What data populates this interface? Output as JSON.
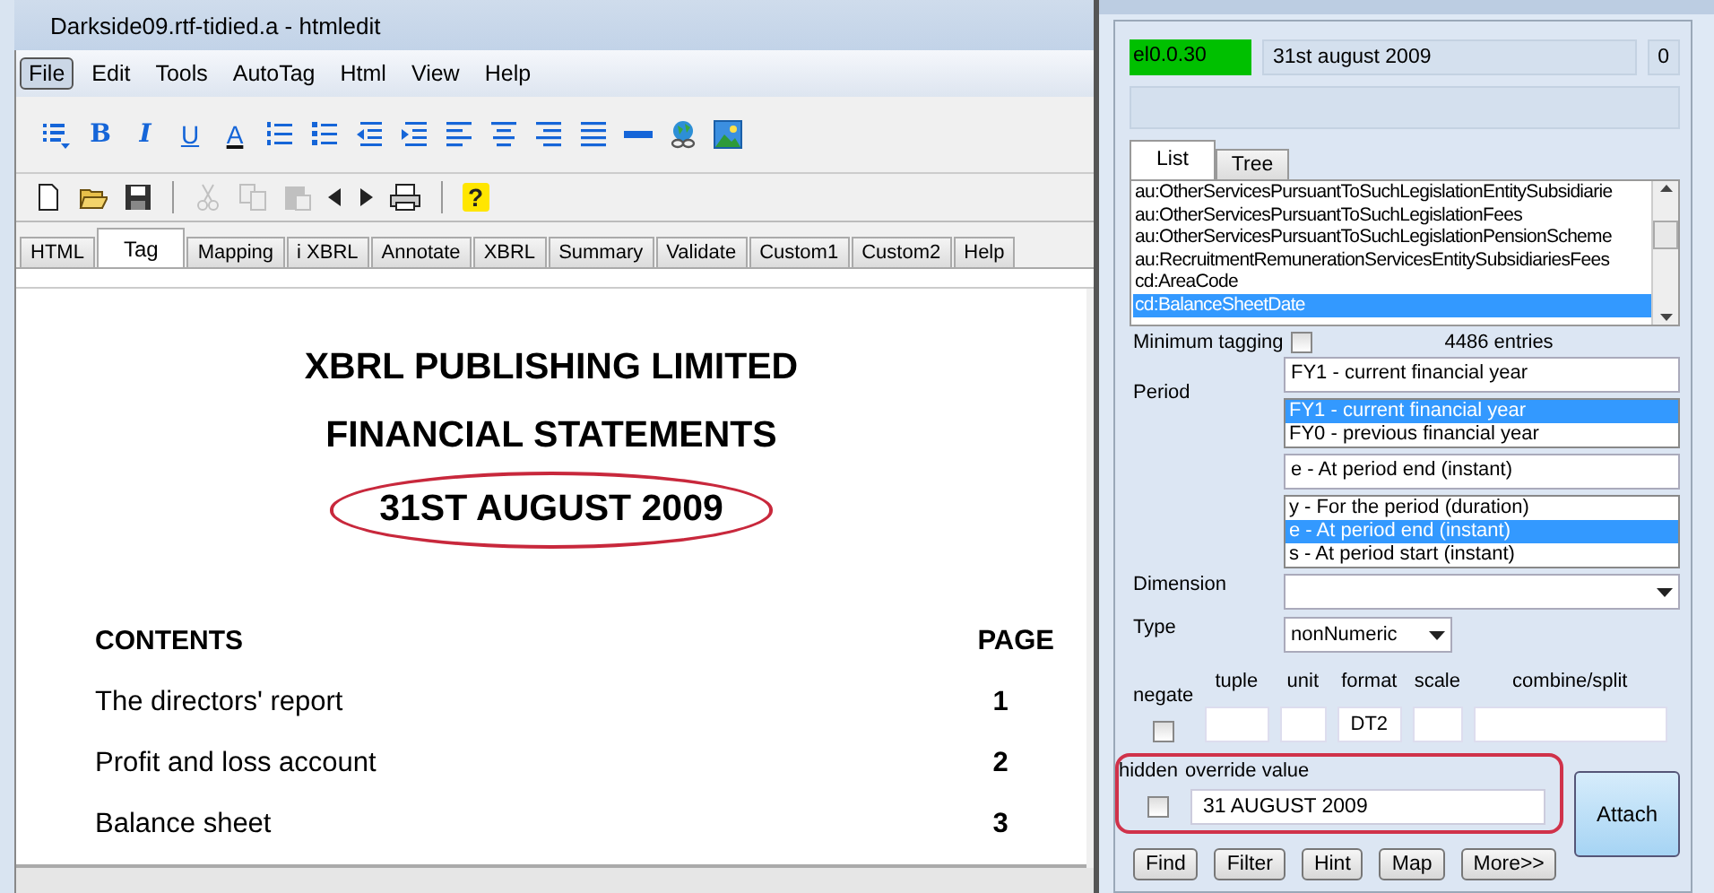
{
  "editor": {
    "title": "Darkside09.rtf-tidied.a - htmledit",
    "menu": [
      {
        "label": "File",
        "selected": true
      },
      {
        "label": "Edit",
        "selected": false
      },
      {
        "label": "Tools",
        "selected": false
      },
      {
        "label": "AutoTag",
        "selected": false
      },
      {
        "label": "Html",
        "selected": false
      },
      {
        "label": "View",
        "selected": false
      },
      {
        "label": "Help",
        "selected": false
      }
    ],
    "format_toolbar": [
      {
        "kind": "list-style"
      },
      {
        "kind": "bold",
        "label": "B"
      },
      {
        "kind": "italic",
        "label": "I"
      },
      {
        "kind": "underline",
        "label": "U"
      },
      {
        "kind": "font-color",
        "label": "A"
      },
      {
        "kind": "numbered-list"
      },
      {
        "kind": "bullet-list"
      },
      {
        "kind": "outdent"
      },
      {
        "kind": "indent"
      },
      {
        "kind": "align-left"
      },
      {
        "kind": "align-center"
      },
      {
        "kind": "align-right"
      },
      {
        "kind": "justify"
      },
      {
        "kind": "rule"
      },
      {
        "kind": "link"
      },
      {
        "kind": "image"
      }
    ],
    "standard_toolbar": [
      {
        "kind": "new",
        "disabled": false
      },
      {
        "kind": "open",
        "disabled": false
      },
      {
        "kind": "save",
        "disabled": false
      },
      {
        "kind": "separator"
      },
      {
        "kind": "cut",
        "disabled": true
      },
      {
        "kind": "copy",
        "disabled": true
      },
      {
        "kind": "paste",
        "disabled": true
      },
      {
        "kind": "back",
        "disabled": false
      },
      {
        "kind": "forward",
        "disabled": false
      },
      {
        "kind": "print",
        "disabled": false
      },
      {
        "kind": "separator"
      },
      {
        "kind": "help",
        "label": "?",
        "disabled": false
      }
    ],
    "tabs": [
      {
        "label": "HTML",
        "selected": false
      },
      {
        "label": "Tag",
        "selected": true
      },
      {
        "label": "Mapping",
        "selected": false
      },
      {
        "label": "i XBRL",
        "selected": false
      },
      {
        "label": "Annotate",
        "selected": false
      },
      {
        "label": "XBRL",
        "selected": false
      },
      {
        "label": "Summary",
        "selected": false
      },
      {
        "label": "Validate",
        "selected": false
      },
      {
        "label": "Custom1",
        "selected": false
      },
      {
        "label": "Custom2",
        "selected": false
      },
      {
        "label": "Help",
        "selected": false
      }
    ],
    "document": {
      "headings": [
        {
          "text": "XBRL PUBLISHING LIMITED",
          "circled": false
        },
        {
          "text": "FINANCIAL STATEMENTS",
          "circled": false
        },
        {
          "text": "31ST AUGUST 2009",
          "circled": true
        }
      ],
      "contents_heading": "CONTENTS",
      "page_heading": "PAGE",
      "entries": [
        {
          "title": "The directors' report",
          "page": "1"
        },
        {
          "title": "Profit and loss account",
          "page": "2"
        },
        {
          "title": "Balance sheet",
          "page": "3"
        }
      ]
    }
  },
  "dialog": {
    "element_id": "el0.0.30",
    "selected_text": "31st august 2009",
    "count": "0",
    "tabs": [
      {
        "label": "List",
        "selected": true
      },
      {
        "label": "Tree",
        "selected": false
      }
    ],
    "list_items": [
      {
        "label": "au:OtherServicesPursuantToSuchLegislationEntitySubsidiarie",
        "selected": false
      },
      {
        "label": "au:OtherServicesPursuantToSuchLegislationFees",
        "selected": false
      },
      {
        "label": "au:OtherServicesPursuantToSuchLegislationPensionScheme",
        "selected": false
      },
      {
        "label": "au:RecruitmentRemunerationServicesEntitySubsidiariesFees",
        "selected": false
      },
      {
        "label": "cd:AreaCode",
        "selected": false
      },
      {
        "label": "cd:BalanceSheetDate",
        "selected": true
      }
    ],
    "minimum_tagging": {
      "label": "Minimum tagging",
      "checked": false
    },
    "entries_count": "4486 entries",
    "period": {
      "label": "Period",
      "value": "FY1 - current financial year",
      "options": [
        {
          "label": "FY1 - current financial year",
          "selected": true
        },
        {
          "label": "FY0 - previous financial year",
          "selected": false
        }
      ]
    },
    "period_type": {
      "value": "e - At period end (instant)",
      "options": [
        {
          "label": "y - For the period (duration)",
          "selected": false
        },
        {
          "label": "e - At period end (instant)",
          "selected": true
        },
        {
          "label": "s - At period start (instant)",
          "selected": false
        }
      ]
    },
    "dimension": {
      "label": "Dimension"
    },
    "type": {
      "label": "Type",
      "value": "nonNumeric"
    },
    "negate": {
      "label": "negate",
      "checked": false
    },
    "fields": [
      {
        "label": "tuple"
      },
      {
        "label": "unit"
      },
      {
        "label": "format",
        "value": "DT2"
      },
      {
        "label": "scale"
      },
      {
        "label": "combine/split"
      }
    ],
    "hidden": {
      "label": "hidden",
      "checked": false
    },
    "override": {
      "label": "override value",
      "value": "31 AUGUST 2009",
      "highlighted": true
    },
    "buttons": [
      "Find",
      "Filter",
      "Hint",
      "Map",
      "More>>"
    ],
    "attach_button": "Attach"
  }
}
